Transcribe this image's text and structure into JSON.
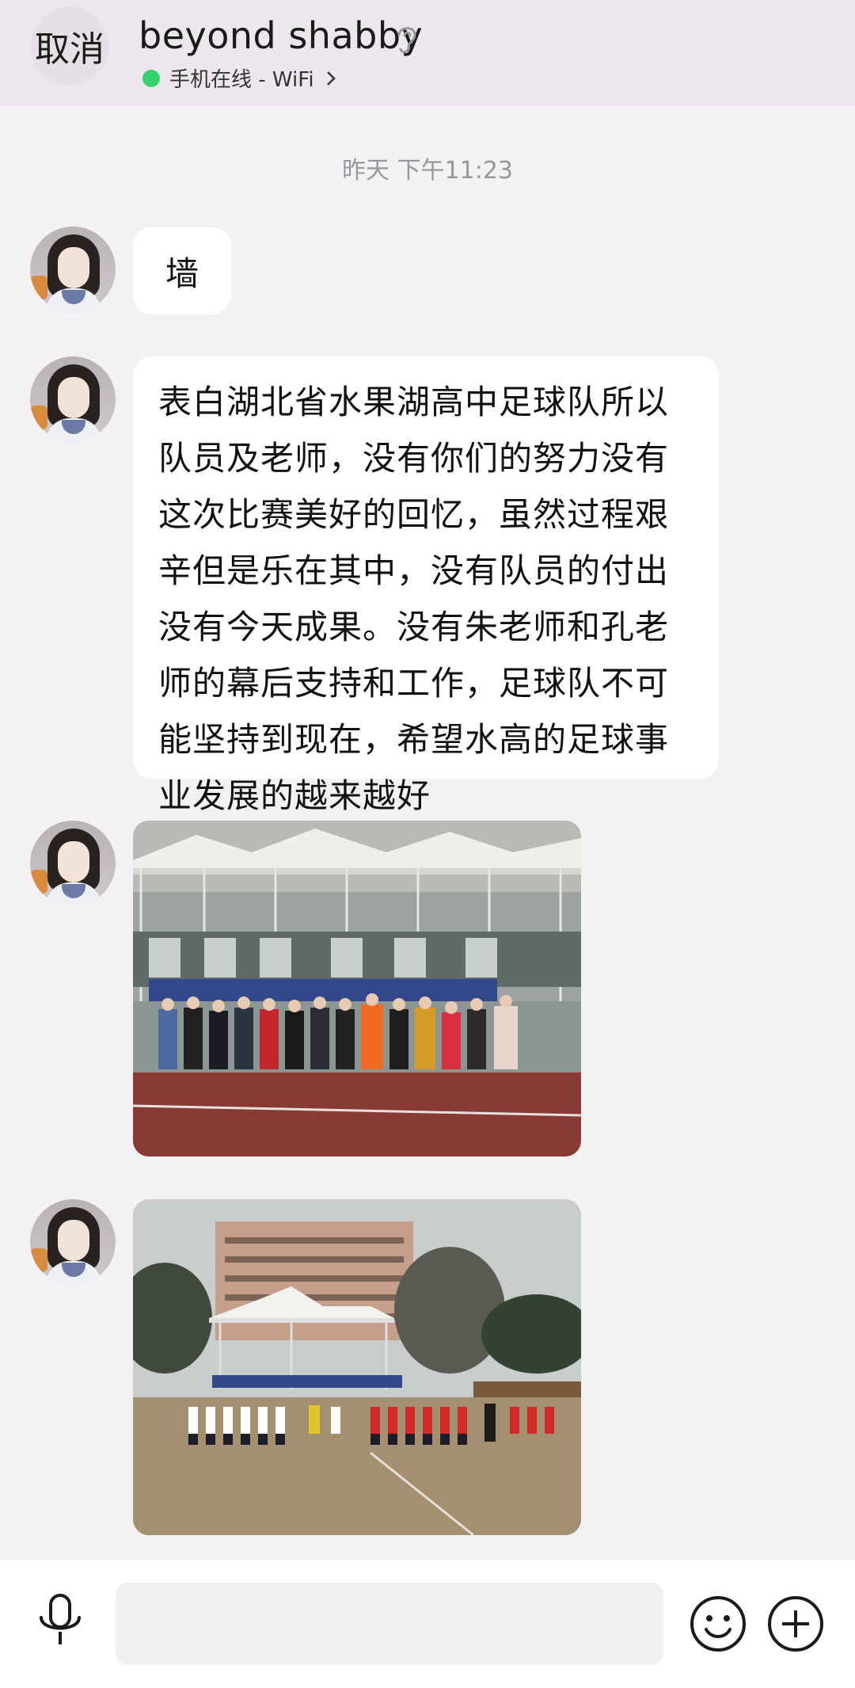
{
  "header": {
    "cancel_label": "取消",
    "contact_name": "beyond shabby",
    "status_text": "手机在线 - WiFi",
    "status_color": "#36d16f"
  },
  "chat": {
    "timestamp": "昨天 下午11:23",
    "messages": [
      {
        "type": "text",
        "text": "墙"
      },
      {
        "type": "text",
        "text": "表白湖北省水果湖高中足球队所以队员及老师，没有你们的努力没有这次比赛美好的回忆，虽然过程艰辛但是乐在其中，没有队员的付出没有今天成果。没有朱老师和孔老师的幕后支持和工作，足球队不可能坚持到现在，希望水高的足球事业发展的越来越好"
      },
      {
        "type": "image",
        "icon": "team-group-photo"
      },
      {
        "type": "image",
        "icon": "match-field-photo"
      }
    ]
  },
  "input_bar": {
    "input_value": "",
    "icons": [
      "microphone-icon",
      "emoji-icon",
      "plus-icon"
    ]
  }
}
